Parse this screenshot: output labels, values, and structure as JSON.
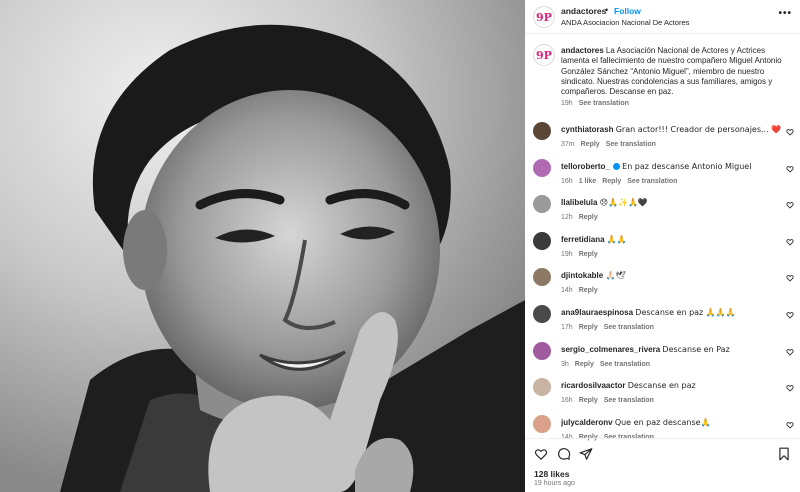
{
  "post": {
    "image_alt": "black-and-white portrait photo of a smiling man resting his chin on his hand"
  },
  "header": {
    "username": "andactores",
    "separator": "•",
    "follow_label": "Follow",
    "subtitle": "ANDA Asociacion Nacional De Actores",
    "more_label": "•••",
    "avatar_text": "9P"
  },
  "caption": {
    "username": "andactores",
    "text": "La Asociación Nacional de Actores y Actrices lamenta el fallecimiento de nuestro compañero Miguel Antonio González Sánchez “Antonio Miguel”, miembro de nuestro sindicato. Nuestras condolencias a sus familiares, amigos y compañeros. Descanse en paz.",
    "time": "19h",
    "see_translation": "See translation"
  },
  "comments": [
    {
      "username": "cynthiatorash",
      "text": "Gran actor!!! Creador de personajes... ❤️",
      "time": "37m",
      "likes": "",
      "reply": "Reply",
      "see_translation": "See translation",
      "avatar_color": "#5a4636"
    },
    {
      "username": "telloroberto_",
      "verified": true,
      "text": "En paz descanse Antonio Miguel",
      "time": "16h",
      "likes": "1 like",
      "reply": "Reply",
      "see_translation": "See translation",
      "avatar_color": "#b06ab3"
    },
    {
      "username": "llalibelula",
      "text": "😞🙏✨🙏🖤",
      "time": "12h",
      "likes": "",
      "reply": "Reply",
      "see_translation": "",
      "avatar_color": "#9a9a9a"
    },
    {
      "username": "ferretidiana",
      "text": "🙏🙏",
      "time": "19h",
      "likes": "",
      "reply": "Reply",
      "see_translation": "",
      "avatar_color": "#3b3b3b"
    },
    {
      "username": "djintokable",
      "text": "🙏🏻🕊",
      "time": "14h",
      "likes": "",
      "reply": "Reply",
      "see_translation": "",
      "avatar_color": "#8c7a66"
    },
    {
      "username": "ana9lauraespinosa",
      "text": "Descanse en paz 🙏🙏🙏",
      "time": "17h",
      "likes": "",
      "reply": "Reply",
      "see_translation": "See translation",
      "avatar_color": "#4a4a4a"
    },
    {
      "username": "sergio_colmenares_rivera",
      "text": "Descanse en Paz",
      "time": "3h",
      "likes": "",
      "reply": "Reply",
      "see_translation": "See translation",
      "avatar_color": "#a05a9e"
    },
    {
      "username": "ricardosilvaactor",
      "text": "Descanse en paz",
      "time": "16h",
      "likes": "",
      "reply": "Reply",
      "see_translation": "See translation",
      "avatar_color": "#c9b3a2"
    },
    {
      "username": "julycalderonv",
      "text": "Que en paz descanse🙏",
      "time": "14h",
      "likes": "",
      "reply": "Reply",
      "see_translation": "See translation",
      "avatar_color": "#d9a08a"
    }
  ],
  "footer": {
    "likes": "128 likes",
    "time_ago": "19 hours ago"
  },
  "icons": {
    "like": "heart-outline-icon",
    "comment": "comment-bubble-icon",
    "share": "paper-plane-icon",
    "save": "bookmark-icon"
  }
}
